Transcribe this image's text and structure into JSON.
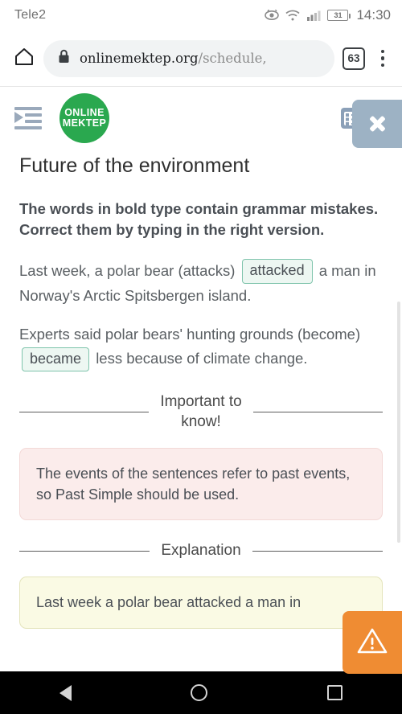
{
  "status_bar": {
    "carrier": "Tele2",
    "battery_level": "31",
    "time": "14:30",
    "icons": [
      "eye-icon",
      "wifi-icon",
      "signal-icon",
      "battery-icon"
    ]
  },
  "browser": {
    "home_icon": "home-icon",
    "lock_icon": "lock-icon",
    "url_domain": "onlinemektep.org",
    "url_path": "/schedule,",
    "tab_count": "63",
    "menu_icon": "kebab-menu-icon"
  },
  "app_header": {
    "indent_icon": "indent-list-icon",
    "logo_line1": "ONLINE",
    "logo_line2": "MEKTEP",
    "list_icon": "list-view-icon",
    "close_label": "✕"
  },
  "lesson": {
    "title": "Future of the environment",
    "instructions": "The words in bold type contain grammar mistakes. Correct them by typing in the right version.",
    "exercises": [
      {
        "before": "Last week, a polar bear (attacks)",
        "answer": "attacked",
        "after": "a man in Norway's Arctic Spitsbergen island."
      },
      {
        "before": "Experts said polar bears' hunting grounds (become)",
        "answer": "became",
        "after": "less because of climate change."
      }
    ],
    "important_divider": "Important to\nknow!",
    "important_text": "The events of the sentences refer to past events, so Past Simple should be used.",
    "explanation_divider": "Explanation",
    "explanation_text": "Last week a polar bear attacked a man in"
  },
  "warning_button": {
    "icon": "warning-triangle-icon",
    "color": "#ef8c33"
  },
  "navigation": {
    "back": "back-button",
    "home": "home-button",
    "recents": "recents-button"
  },
  "colors": {
    "brand_green": "#2aa84f",
    "answer_border": "#7fc4ac",
    "answer_bg": "#edf7f2",
    "pink_bg": "#fbeceb",
    "yellow_bg": "#fafae4",
    "warn_orange": "#ef8c33",
    "header_gray": "#9db2c4"
  }
}
